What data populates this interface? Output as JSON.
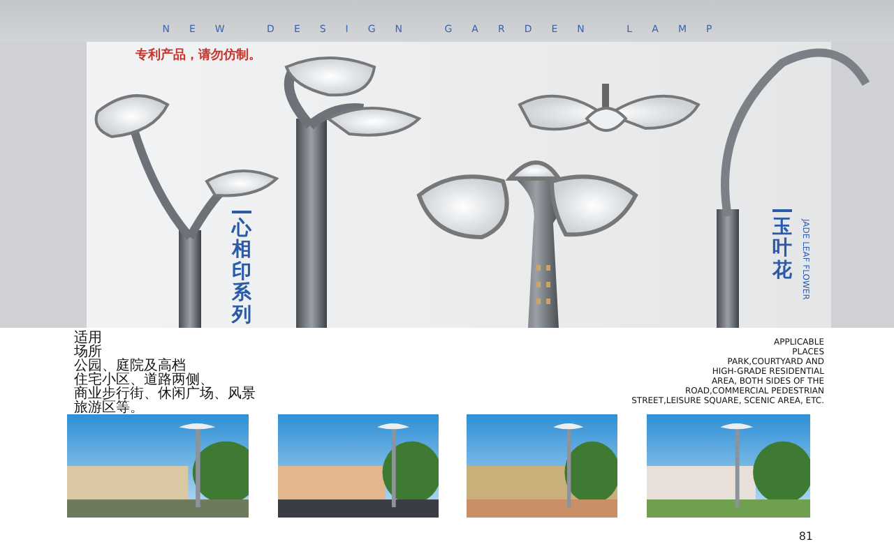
{
  "header": {
    "title": "NEW DESIGN GARDEN LAMP",
    "notice": "专利产品，请勿仿制。"
  },
  "series": [
    {
      "name": "心相印系列"
    },
    {
      "name": "玉叶花",
      "english": "JADE LEAF FLOWER"
    }
  ],
  "applicable_zh": [
    "适用",
    "场所",
    "公园、庭院及高档",
    "住宅小区、道路两侧、",
    "商业步行街、休闲广场、风景",
    "旅游区等。"
  ],
  "applicable_en": [
    "APPLICABLE",
    "PLACES",
    "PARK,COURTYARD AND",
    "HIGH-GRADE RESIDENTIAL",
    "AREA, BOTH SIDES OF THE",
    "ROAD,COMMERCIAL  PEDESTRIAN",
    "STREET,LEISURE SQUARE, SCENIC AREA, ETC."
  ],
  "page_number": "81"
}
